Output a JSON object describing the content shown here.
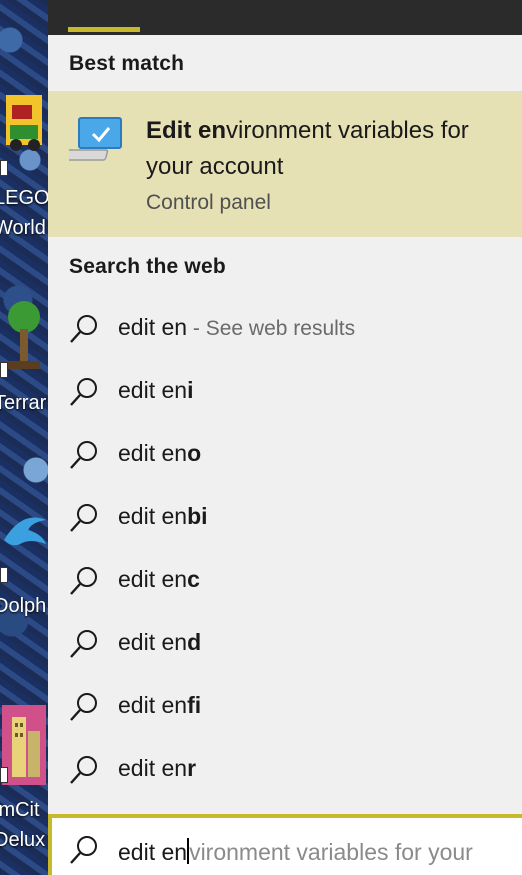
{
  "desktop": {
    "icons": [
      {
        "name": "lego-worlds",
        "label_line1": "LEGO",
        "label_line2": "World"
      },
      {
        "name": "terraria",
        "label_line1": "Terrar"
      },
      {
        "name": "dolphin",
        "label_line1": "Dolph"
      },
      {
        "name": "simcity",
        "label_line1": "imCit",
        "label_line2": "Delux"
      }
    ]
  },
  "best_match": {
    "header": "Best match",
    "title_bold": "Edit en",
    "title_rest": "vironment variables for your account",
    "subtitle": "Control panel",
    "icon": "control-panel-monitor-icon"
  },
  "web": {
    "header": "Search the web",
    "results": [
      {
        "base": "edit en",
        "suffix": "",
        "hint": " - See web results"
      },
      {
        "base": "edit en",
        "suffix": "i",
        "hint": ""
      },
      {
        "base": "edit en",
        "suffix": "o",
        "hint": ""
      },
      {
        "base": "edit en",
        "suffix": "bi",
        "hint": ""
      },
      {
        "base": "edit en",
        "suffix": "c",
        "hint": ""
      },
      {
        "base": "edit en",
        "suffix": "d",
        "hint": ""
      },
      {
        "base": "edit en",
        "suffix": "fi",
        "hint": ""
      },
      {
        "base": "edit en",
        "suffix": "r",
        "hint": ""
      }
    ]
  },
  "search": {
    "typed": "edit en",
    "autocomplete": "vironment variables for your",
    "icon": "search-icon"
  },
  "colors": {
    "accent": "#c8b82c",
    "best_match_bg": "#e6e0b5",
    "panel_bg": "#f0f0f0",
    "topbar_bg": "#2b2b2b"
  }
}
